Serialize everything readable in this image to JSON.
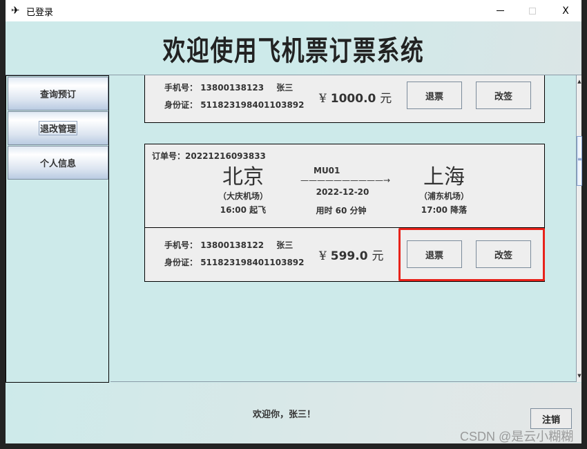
{
  "window": {
    "title": "已登录",
    "app_icon": "airplane-icon",
    "controls": {
      "minimize": "minimize-icon",
      "maximize": "maximize-icon",
      "close_label": "X"
    }
  },
  "header": {
    "title": "欢迎使用飞机票订票系统"
  },
  "sidebar": {
    "items": [
      {
        "label": "查询预订",
        "active": false
      },
      {
        "label": "退改管理",
        "active": true
      },
      {
        "label": "个人信息",
        "active": false
      }
    ]
  },
  "orders": [
    {
      "phone_label": "手机号：",
      "phone": "13800138123",
      "name": "张三",
      "id_label": "身份证：",
      "id_number": "511823198401103892",
      "currency": "¥",
      "price": "1000.0",
      "unit": "元",
      "refund_label": "退票",
      "change_label": "改签"
    },
    {
      "order_label": "订单号：",
      "order_number": "20221216093833",
      "from_city": "北京",
      "from_airport": "（大庆机场）",
      "depart_time": "16:00 起飞",
      "flight_no": "MU01",
      "arrow": "——————————→",
      "date": "2022-12-20",
      "duration": "用时 60 分钟",
      "to_city": "上海",
      "to_airport": "（浦东机场）",
      "arrive_time": "17:00 降落",
      "phone_label": "手机号：",
      "phone": "13800138122",
      "name": "张三",
      "id_label": "身份证：",
      "id_number": "511823198401103892",
      "currency": "¥",
      "price": "599.0",
      "unit": "元",
      "refund_label": "退票",
      "change_label": "改签",
      "highlight_color": "#e8221a"
    }
  ],
  "footer": {
    "welcome": "欢迎你，张三！",
    "logout_label": "注销",
    "watermark": "CSDN @是云小糊糊"
  }
}
